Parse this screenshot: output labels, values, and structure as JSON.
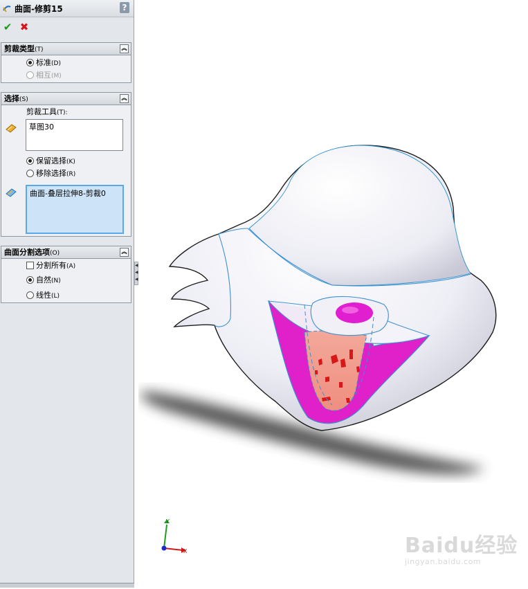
{
  "panel": {
    "title": "曲面-修剪15",
    "help": "?",
    "ok_symbol": "✔",
    "cancel_symbol": "✖"
  },
  "trim_type": {
    "heading": "剪裁类型",
    "heading_suffix": "(T)",
    "options": [
      {
        "label": "标准",
        "suffix": "(D)",
        "selected": true,
        "enabled": true
      },
      {
        "label": "相互",
        "suffix": "(M)",
        "selected": false,
        "enabled": false
      }
    ]
  },
  "selections": {
    "heading": "选择",
    "heading_suffix": "(S)",
    "trim_tool_label": "剪裁工具",
    "trim_tool_suffix": "(T):",
    "trim_tool_value": "草图30",
    "keep_label": "保留选择",
    "keep_suffix": "(K)",
    "remove_label": "移除选择",
    "remove_suffix": "(R)",
    "pieces_value": "曲面-叠层拉伸8-剪裁0"
  },
  "split_options": {
    "heading": "曲面分割选项",
    "heading_suffix": "(O)",
    "split_all_label": "分割所有",
    "split_all_suffix": "(A)",
    "natural_label": "自然",
    "natural_suffix": "(N)",
    "linear_label": "线性",
    "linear_suffix": "(L)"
  },
  "triad": {
    "x": "X",
    "y": "Y"
  },
  "watermark": {
    "line1": "Baidu经验",
    "line2": "jingyan.baidu.com"
  },
  "colors": {
    "accent_blue": "#3c8fd0",
    "magenta": "#e020c8",
    "ok": "#1a9a1a",
    "cancel": "#d8141a"
  }
}
